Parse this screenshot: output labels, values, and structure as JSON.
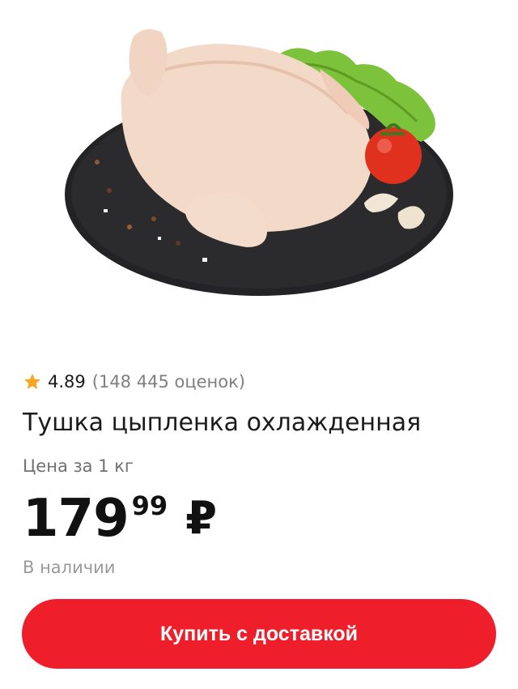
{
  "product": {
    "image_alt": "chicken-on-slate-board",
    "rating_value": "4.89",
    "rating_count": "(148 445 оценок)",
    "title": "Тушка цыпленка охлажденная",
    "unit_label": "Цена за 1 кг",
    "price_integer": "179",
    "price_fraction": "99",
    "currency": "₽",
    "availability": "В наличии"
  },
  "actions": {
    "buy_label": "Купить с доставкой"
  },
  "icons": {
    "rating": "star-icon"
  },
  "colors": {
    "accent": "#ee1f2b",
    "star": "#f5a623",
    "secondary_text": "#7f7f7f"
  }
}
